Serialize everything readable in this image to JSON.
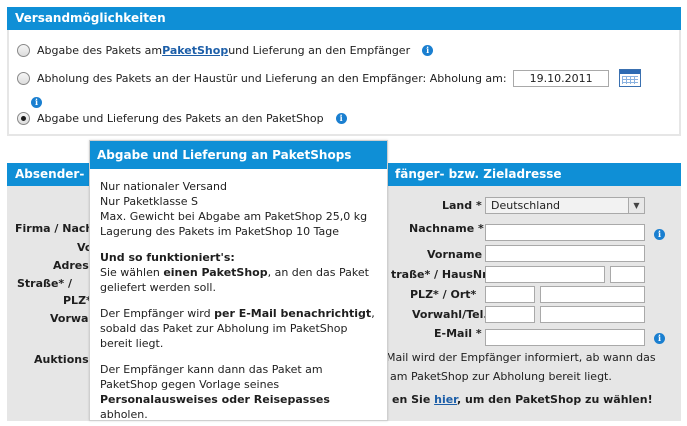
{
  "versand": {
    "title": "Versandmöglichkeiten",
    "options": [
      {
        "pre": "Abgabe des Pakets am ",
        "link": "PaketShop",
        "post": " und Lieferung an den Empfänger",
        "checked": false
      },
      {
        "text": "Abholung des Pakets an der Haustür und Lieferung an den Empfänger: Abholung am:",
        "date": "19.10.2011",
        "checked": false
      },
      {
        "text": "Abgabe und Lieferung des Pakets an den PaketShop",
        "checked": true
      }
    ]
  },
  "adressen": {
    "title_left": "Absender- bz",
    "title_right": "fänger- bzw. Zieladresse",
    "left_labels": [
      "Firma / Nach",
      "Vo",
      "Adress",
      "Straße* /",
      "PLZ*",
      "Vorwa",
      "Auktionsn"
    ],
    "right": {
      "land_label": "Land *",
      "land_value": "Deutschland",
      "nachname_label": "Nachname *",
      "vorname_label": "Vorname",
      "strasse_label": "traße* / HausNr",
      "plz_label": "PLZ* / Ort*",
      "vorwahl_label": "Vorwahl/Tel.",
      "email_label": "E-Mail *",
      "note_line1": "-Mail wird der Empfänger informiert, ab wann das",
      "note_line2": "r am PaketShop zur Abholung bereit liegt.",
      "hint_pre": "en Sie ",
      "hint_link": "hier",
      "hint_post": ", um den PaketShop zu wählen!"
    }
  },
  "tooltip": {
    "title": "Abgabe und Lieferung an PaketShops",
    "lines": [
      "Nur nationaler Versand",
      "Nur Paketklasse S",
      "Max. Gewicht bei Abgabe am PaketShop 25,0 kg",
      "Lagerung des Pakets im PaketShop 10 Tage"
    ],
    "how_title": "Und so funktioniert's:",
    "how_1": "Sie wählen ",
    "how_1b": "einen PaketShop",
    "how_1c": ", an den das Paket geliefert werden soll.",
    "notify_1": "Der Empfänger wird ",
    "notify_1b": "per E-Mail benachrichtigt",
    "notify_1c": ", sobald das Paket zur Abholung im PaketShop bereit liegt.",
    "pickup_1": "Der Empfänger kann dann das Paket am PaketShop gegen Vorlage seines ",
    "pickup_1b": "Personalausweises oder Reisepasses",
    "pickup_1c": " abholen."
  },
  "icons": {
    "info": "info-icon",
    "calendar": "calendar-icon",
    "dropdown": "chevron-down-icon"
  },
  "colors": {
    "header_blue": "#0f8fd6",
    "link_blue": "#1c5ea8",
    "panel_gray": "#e6e6e6"
  }
}
